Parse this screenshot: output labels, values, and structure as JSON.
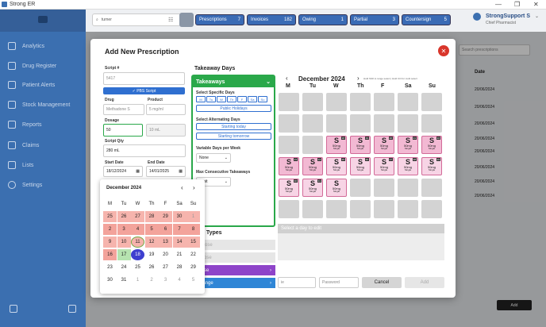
{
  "window": {
    "title": "Strong ER",
    "controls": [
      "—",
      "❐",
      "✕"
    ]
  },
  "sidebar": {
    "items": [
      {
        "label": "Analytics"
      },
      {
        "label": "Drug Register"
      },
      {
        "label": "Patient Alerts"
      },
      {
        "label": "Stock Management"
      },
      {
        "label": "Reports"
      },
      {
        "label": "Claims"
      },
      {
        "label": "Lists"
      },
      {
        "label": "Settings"
      }
    ]
  },
  "topbar": {
    "search_value": "turner",
    "chips": [
      {
        "label": "Prescriptions",
        "count": "7"
      },
      {
        "label": "Invoices",
        "count": "182"
      },
      {
        "label": "Owing",
        "count": "1"
      },
      {
        "label": "Partial",
        "count": "3"
      },
      {
        "label": "Countersign",
        "count": "5"
      }
    ],
    "user_name": "StrongSupport S",
    "user_role": "Chief Pharmacist"
  },
  "background": {
    "search_placeholder": "Search prescriptions",
    "date_header": "Date",
    "dates": [
      "20/06/2024",
      "20/06/2024",
      "20/06/2024",
      "20/06/2024",
      "20/06/2024",
      "20/06/2024",
      "20/06/2024",
      "20/06/2024"
    ],
    "add_label": "Add"
  },
  "modal": {
    "title": "Add New Prescription",
    "script_label": "Script #",
    "script_placeholder": "5417",
    "pbs_label": "✓ PBS Script",
    "drug_label": "Drug",
    "drug_value": "Methadone S",
    "product_label": "Product",
    "product_value": "5 mg/ml",
    "dosage_label": "Dosage",
    "dosage_value": "50",
    "dosage_unit": "10 mL",
    "qty_label": "Script Qty",
    "qty_value": "280 mL",
    "start_label": "Start Date",
    "start_value": "18/12/2024",
    "end_label": "End Date",
    "end_value": "14/01/2025",
    "takeaway": {
      "section": "Takeaway Days",
      "panel_title": "Takeaways",
      "specific_label": "Select Specific Days",
      "days": [
        "M",
        "Tu",
        "W",
        "Th",
        "F",
        "Sa",
        "Su"
      ],
      "public_holidays": "Public Holidays",
      "alt_label": "Select Alternating Days",
      "alt_today": "Starting today",
      "alt_tomorrow": "Starting tomorrow",
      "variable_label": "Variable Days per Week",
      "variable_value": "None",
      "max_label": "Max Consecutive Takeaways",
      "max_value": "Limit"
    },
    "dose_types": {
      "title": "e Types",
      "items": [
        {
          "label": "ile Dose",
          "color": "#e6e6e6"
        },
        {
          "label": "ut Dose",
          "color": "#e6e6e6"
        },
        {
          "label": "t Dose",
          "color": "#8e44c9"
        },
        {
          "label": "e Range",
          "color": "#2f86d6"
        }
      ]
    },
    "calendar": {
      "month": "December 2024",
      "hint": "Hold Shift to range select | Hold Ctrl for multi select",
      "weekdays": [
        "M",
        "Tu",
        "W",
        "Th",
        "F",
        "Sa",
        "Su"
      ],
      "dose_text": "50mg",
      "single_text": "Single",
      "s_text": "S",
      "days": [
        "18",
        "19",
        "20",
        "21",
        "22",
        "23",
        "24",
        "25",
        "26",
        "27",
        "28",
        "29",
        "30",
        "31"
      ]
    },
    "edit_placeholder": "Select a day to edit",
    "password_placeholder": "Password",
    "cancel_label": "Cancel",
    "add_label": "Add",
    "footer_left": "ie",
    "datepicker": {
      "month": "December 2024",
      "weekdays": [
        "M",
        "Tu",
        "W",
        "Th",
        "F",
        "Sa",
        "Su"
      ],
      "rows": [
        [
          "25",
          "26",
          "27",
          "28",
          "29",
          "30",
          "1"
        ],
        [
          "2",
          "3",
          "4",
          "5",
          "6",
          "7",
          "8"
        ],
        [
          "9",
          "10",
          "11",
          "12",
          "13",
          "14",
          "15"
        ],
        [
          "16",
          "17",
          "18",
          "19",
          "20",
          "21",
          "22"
        ],
        [
          "23",
          "24",
          "25",
          "26",
          "27",
          "28",
          "29"
        ],
        [
          "30",
          "31",
          "1",
          "2",
          "3",
          "4",
          "5"
        ]
      ]
    }
  }
}
